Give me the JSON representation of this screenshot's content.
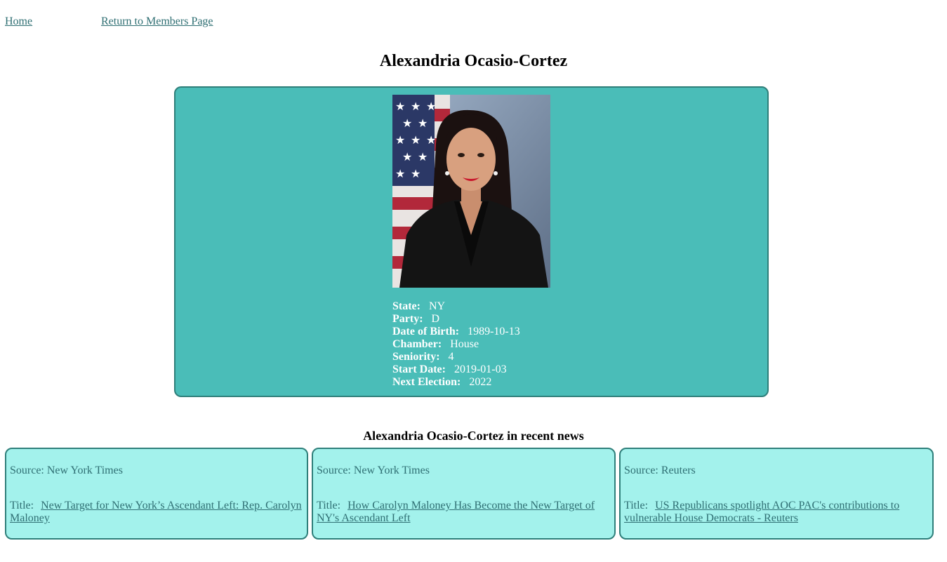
{
  "nav": {
    "home_label": "Home",
    "members_label": "Return to Members Page"
  },
  "member": {
    "name": "Alexandria Ocasio-Cortez",
    "photo_icon": "member-portrait-photo",
    "details": [
      {
        "label": "State:",
        "value": "NY"
      },
      {
        "label": "Party:",
        "value": "D"
      },
      {
        "label": "Date of Birth:",
        "value": "1989-10-13"
      },
      {
        "label": "Chamber:",
        "value": "House"
      },
      {
        "label": "Seniority:",
        "value": "4"
      },
      {
        "label": "Start Date:",
        "value": "2019-01-03"
      },
      {
        "label": "Next Election:",
        "value": "2022"
      }
    ]
  },
  "news": {
    "heading": "Alexandria Ocasio-Cortez in recent news",
    "source_prefix": "Source:",
    "title_prefix": "Title:",
    "items": [
      {
        "source": "New York Times",
        "title": "New Target for New York’s Ascendant Left: Rep. Carolyn Maloney"
      },
      {
        "source": "New York Times",
        "title": "How Carolyn Maloney Has Become the New Target of NY's Ascendant Left"
      },
      {
        "source": "Reuters",
        "title": "US Republicans spotlight AOC PAC's contributions to vulnerable House Democrats - Reuters"
      }
    ]
  },
  "colors": {
    "profile_card_bg": "#4abdb8",
    "news_card_bg": "#a3f2ec",
    "border": "#2f7f7a",
    "link": "#2f6f73"
  }
}
